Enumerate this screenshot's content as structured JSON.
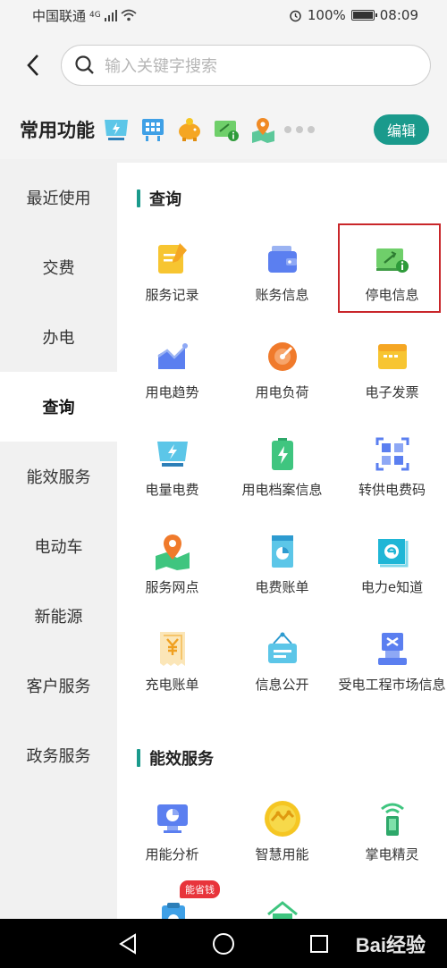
{
  "status_bar": {
    "carrier": "中国联通",
    "network": "4G",
    "battery": "100%",
    "time": "08:09"
  },
  "search": {
    "placeholder": "输入关键字搜索"
  },
  "common": {
    "title": "常用功能",
    "edit_label": "编辑",
    "icons": [
      "electricity-bill-icon",
      "building-icon",
      "piggy-bank-icon",
      "outage-info-icon",
      "service-outlet-icon"
    ]
  },
  "sidebar": {
    "items": [
      {
        "label": "最近使用"
      },
      {
        "label": "交费"
      },
      {
        "label": "办电"
      },
      {
        "label": "查询",
        "active": true
      },
      {
        "label": "能效服务"
      },
      {
        "label": "电动车"
      },
      {
        "label": "新能源"
      },
      {
        "label": "客户服务"
      },
      {
        "label": "政务服务"
      }
    ]
  },
  "sections": [
    {
      "title": "查询",
      "items": [
        {
          "label": "服务记录",
          "icon": "service-record-icon"
        },
        {
          "label": "账务信息",
          "icon": "wallet-icon"
        },
        {
          "label": "停电信息",
          "icon": "outage-info-icon",
          "highlighted": true
        },
        {
          "label": "用电趋势",
          "icon": "usage-trend-icon"
        },
        {
          "label": "用电负荷",
          "icon": "load-gauge-icon"
        },
        {
          "label": "电子发票",
          "icon": "invoice-icon"
        },
        {
          "label": "电量电费",
          "icon": "electricity-fee-icon"
        },
        {
          "label": "用电档案信息",
          "icon": "battery-file-icon"
        },
        {
          "label": "转供电费码",
          "icon": "qr-code-icon"
        },
        {
          "label": "服务网点",
          "icon": "map-pin-icon"
        },
        {
          "label": "电费账单",
          "icon": "bill-icon"
        },
        {
          "label": "电力e知道",
          "icon": "book-icon"
        },
        {
          "label": "充电账单",
          "icon": "yuan-receipt-icon"
        },
        {
          "label": "信息公开",
          "icon": "notice-board-icon"
        },
        {
          "label": "受电工程市场信息",
          "icon": "engineering-icon"
        }
      ]
    },
    {
      "title": "能效服务",
      "items": [
        {
          "label": "用能分析",
          "icon": "monitor-chart-icon"
        },
        {
          "label": "智慧用能",
          "icon": "smart-energy-icon"
        },
        {
          "label": "掌电精灵",
          "icon": "phone-signal-icon"
        },
        {
          "label": "",
          "icon": "clipboard-icon",
          "badge": "能省钱"
        },
        {
          "label": "",
          "icon": "house-icon"
        }
      ]
    }
  ],
  "watermark": "Bai经验",
  "colors": {
    "accent": "#1a9a8c",
    "highlight_border": "#c9262a",
    "badge": "#e8343b"
  }
}
